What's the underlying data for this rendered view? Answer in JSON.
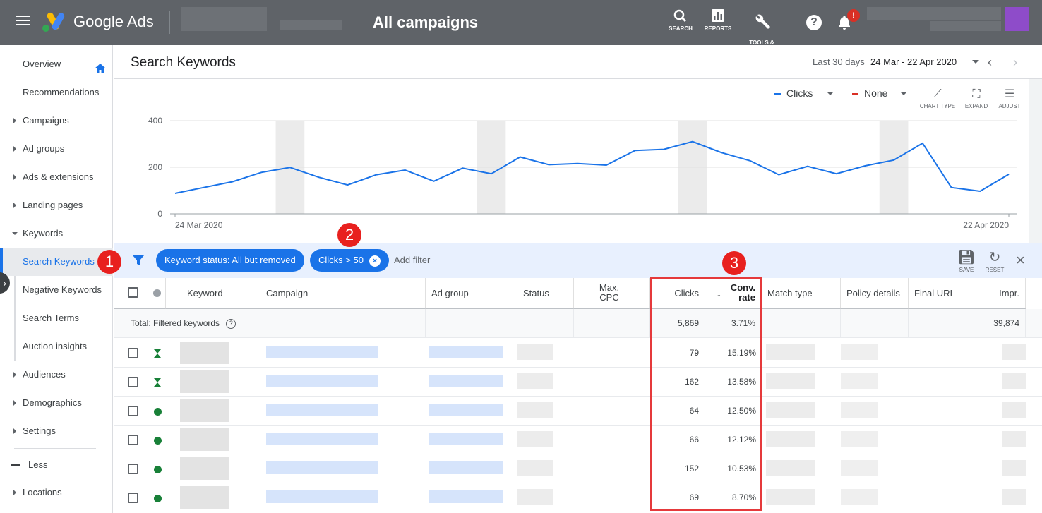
{
  "app": {
    "brand": "Google Ads",
    "page_title": "All campaigns",
    "actions": [
      {
        "label": "SEARCH",
        "icon": "search-icon"
      },
      {
        "label": "REPORTS",
        "icon": "bar-chart-icon"
      },
      {
        "label": "TOOLS &\nSETTINGS",
        "icon": "wrench-icon"
      }
    ],
    "notification_badge": "!"
  },
  "sidebar": {
    "items": [
      {
        "label": "Overview",
        "type": "plain"
      },
      {
        "label": "Recommendations",
        "type": "plain"
      },
      {
        "label": "Campaigns",
        "type": "expand"
      },
      {
        "label": "Ad groups",
        "type": "expand"
      },
      {
        "label": "Ads & extensions",
        "type": "expand"
      },
      {
        "label": "Landing pages",
        "type": "expand"
      },
      {
        "label": "Keywords",
        "type": "expanded"
      },
      {
        "label": "Search Keywords",
        "type": "active"
      },
      {
        "label": "Negative Keywords",
        "type": "sub"
      },
      {
        "label": "Search Terms",
        "type": "sub"
      },
      {
        "label": "Auction insights",
        "type": "sub"
      },
      {
        "label": "Audiences",
        "type": "expand"
      },
      {
        "label": "Demographics",
        "type": "expand"
      },
      {
        "label": "Settings",
        "type": "expand"
      }
    ],
    "less_label": "Less",
    "locations_label": "Locations"
  },
  "main": {
    "title": "Search Keywords",
    "date_label": "Last 30 days",
    "date_range": "24 Mar - 22 Apr 2020"
  },
  "chart_controls": {
    "metric1": "Clicks",
    "metric2": "None",
    "metric1_color": "#1a73e8",
    "metric2_color": "#d93025",
    "tools": [
      {
        "label": "CHART TYPE",
        "icon": "chart-type-icon"
      },
      {
        "label": "EXPAND",
        "icon": "expand-icon"
      },
      {
        "label": "ADJUST",
        "icon": "adjust-icon"
      }
    ]
  },
  "chart_data": {
    "type": "line",
    "series": [
      {
        "name": "Clicks",
        "color": "#1a73e8",
        "values": [
          88,
          113,
          138,
          178,
          199,
          157,
          124,
          168,
          188,
          140,
          196,
          172,
          244,
          211,
          216,
          209,
          272,
          277,
          310,
          263,
          228,
          168,
          204,
          172,
          206,
          231,
          303,
          113,
          97,
          170
        ]
      }
    ],
    "x_start_label": "24 Mar 2020",
    "x_end_label": "22 Apr 2020",
    "y_ticks": [
      "400",
      "200",
      "0"
    ],
    "ylim": [
      0,
      400
    ],
    "weekend_shading": true
  },
  "filters": {
    "chips": [
      "Keyword status: All but removed",
      "Clicks > 50"
    ],
    "add_filter": "Add filter",
    "save_label": "SAVE",
    "reset_label": "RESET"
  },
  "table": {
    "columns": [
      "Keyword",
      "Campaign",
      "Ad group",
      "Status",
      "Max.\nCPC",
      "Clicks",
      "Conv.\nrate",
      "Match type",
      "Policy details",
      "Final URL",
      "Impr."
    ],
    "total": {
      "label": "Total: Filtered keywords",
      "clicks": "5,869",
      "conv_rate": "3.71%",
      "impr": "39,874"
    },
    "rows": [
      {
        "status": "triangle",
        "clicks": "79",
        "conv_rate": "15.19%"
      },
      {
        "status": "triangle",
        "clicks": "162",
        "conv_rate": "13.58%"
      },
      {
        "status": "dot",
        "clicks": "64",
        "conv_rate": "12.50%"
      },
      {
        "status": "dot",
        "clicks": "66",
        "conv_rate": "12.12%"
      },
      {
        "status": "dot",
        "clicks": "152",
        "conv_rate": "10.53%"
      },
      {
        "status": "dot",
        "clicks": "69",
        "conv_rate": "8.70%"
      }
    ]
  },
  "callouts": [
    "1",
    "2",
    "3"
  ]
}
